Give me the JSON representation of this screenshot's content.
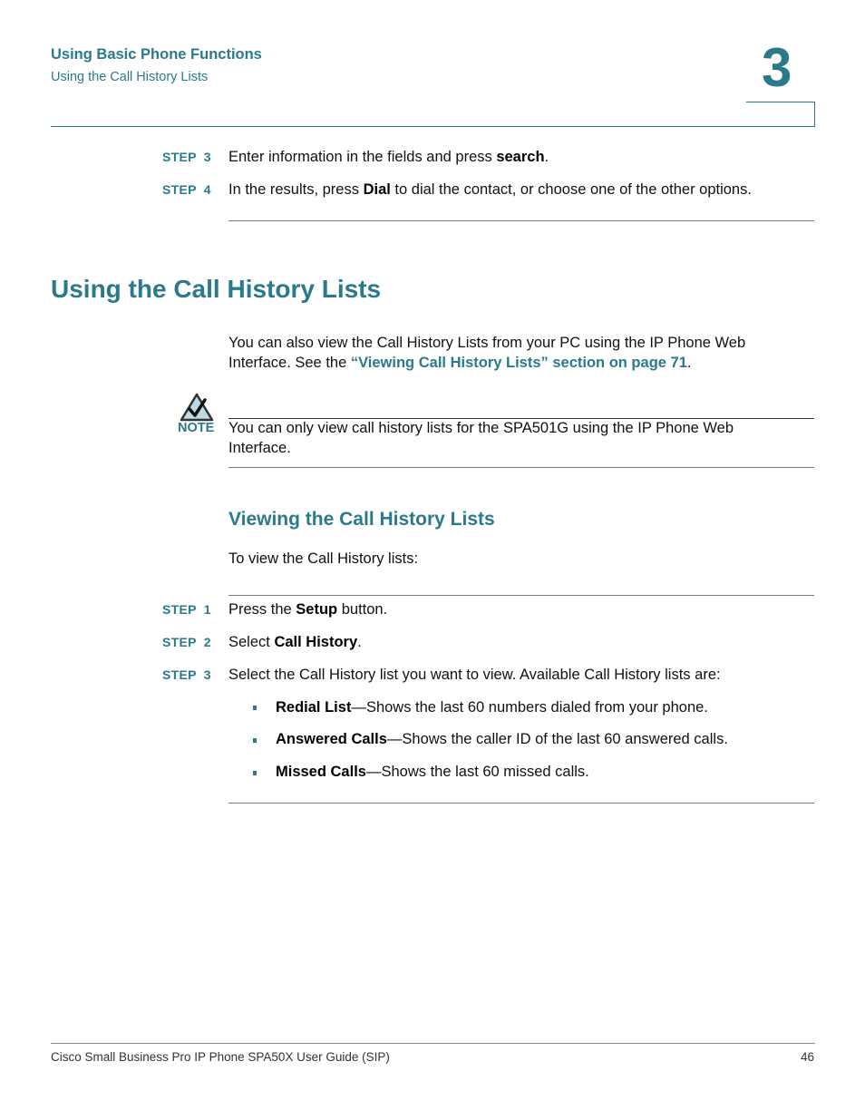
{
  "header": {
    "chapter_title": "Using Basic Phone Functions",
    "section_title": "Using the Call History Lists",
    "chapter_number": "3"
  },
  "steps_top": [
    {
      "label": "STEP",
      "num": "3",
      "pre": "Enter information in the fields and press ",
      "bold": "search",
      "post": "."
    },
    {
      "label": "STEP",
      "num": "4",
      "pre": "In the results, press ",
      "bold": "Dial",
      "post": " to dial the contact, or choose one of the other options."
    }
  ],
  "section": {
    "heading": "Using the Call History Lists",
    "intro_line1": "You can also view the Call History Lists from your PC using the IP Phone Web",
    "intro_line2_pre": "Interface. See the ",
    "intro_link": "“Viewing Call History Lists” section on page 71",
    "intro_line2_post": "."
  },
  "note": {
    "icon": "checkmark-triangle-icon",
    "label": "NOTE",
    "line1": "You can only view call history lists for the SPA501G using the IP Phone Web",
    "line2": "Interface."
  },
  "subsection": {
    "heading": "Viewing the Call History Lists",
    "intro": "To view the Call History lists:"
  },
  "steps_bottom": [
    {
      "label": "STEP",
      "num": "1",
      "pre": "Press the ",
      "bold": "Setup",
      "post": " button."
    },
    {
      "label": "STEP",
      "num": "2",
      "pre": "Select ",
      "bold": "Call History",
      "post": "."
    },
    {
      "label": "STEP",
      "num": "3",
      "pre": "Select the Call History list you want to view. Available Call History lists are:",
      "bold": "",
      "post": ""
    }
  ],
  "bullets": [
    {
      "bold": "Redial List",
      "text": "—Shows the last 60 numbers dialed from your phone."
    },
    {
      "bold": "Answered Calls",
      "text": "—Shows the caller ID of the last 60 answered calls."
    },
    {
      "bold": "Missed Calls",
      "text": "—Shows the last 60 missed calls."
    }
  ],
  "footer": {
    "title": "Cisco Small Business Pro IP Phone SPA50X User Guide (SIP)",
    "page_number": "46"
  },
  "colors": {
    "accent": "#2a7a8c",
    "text": "#111111"
  }
}
